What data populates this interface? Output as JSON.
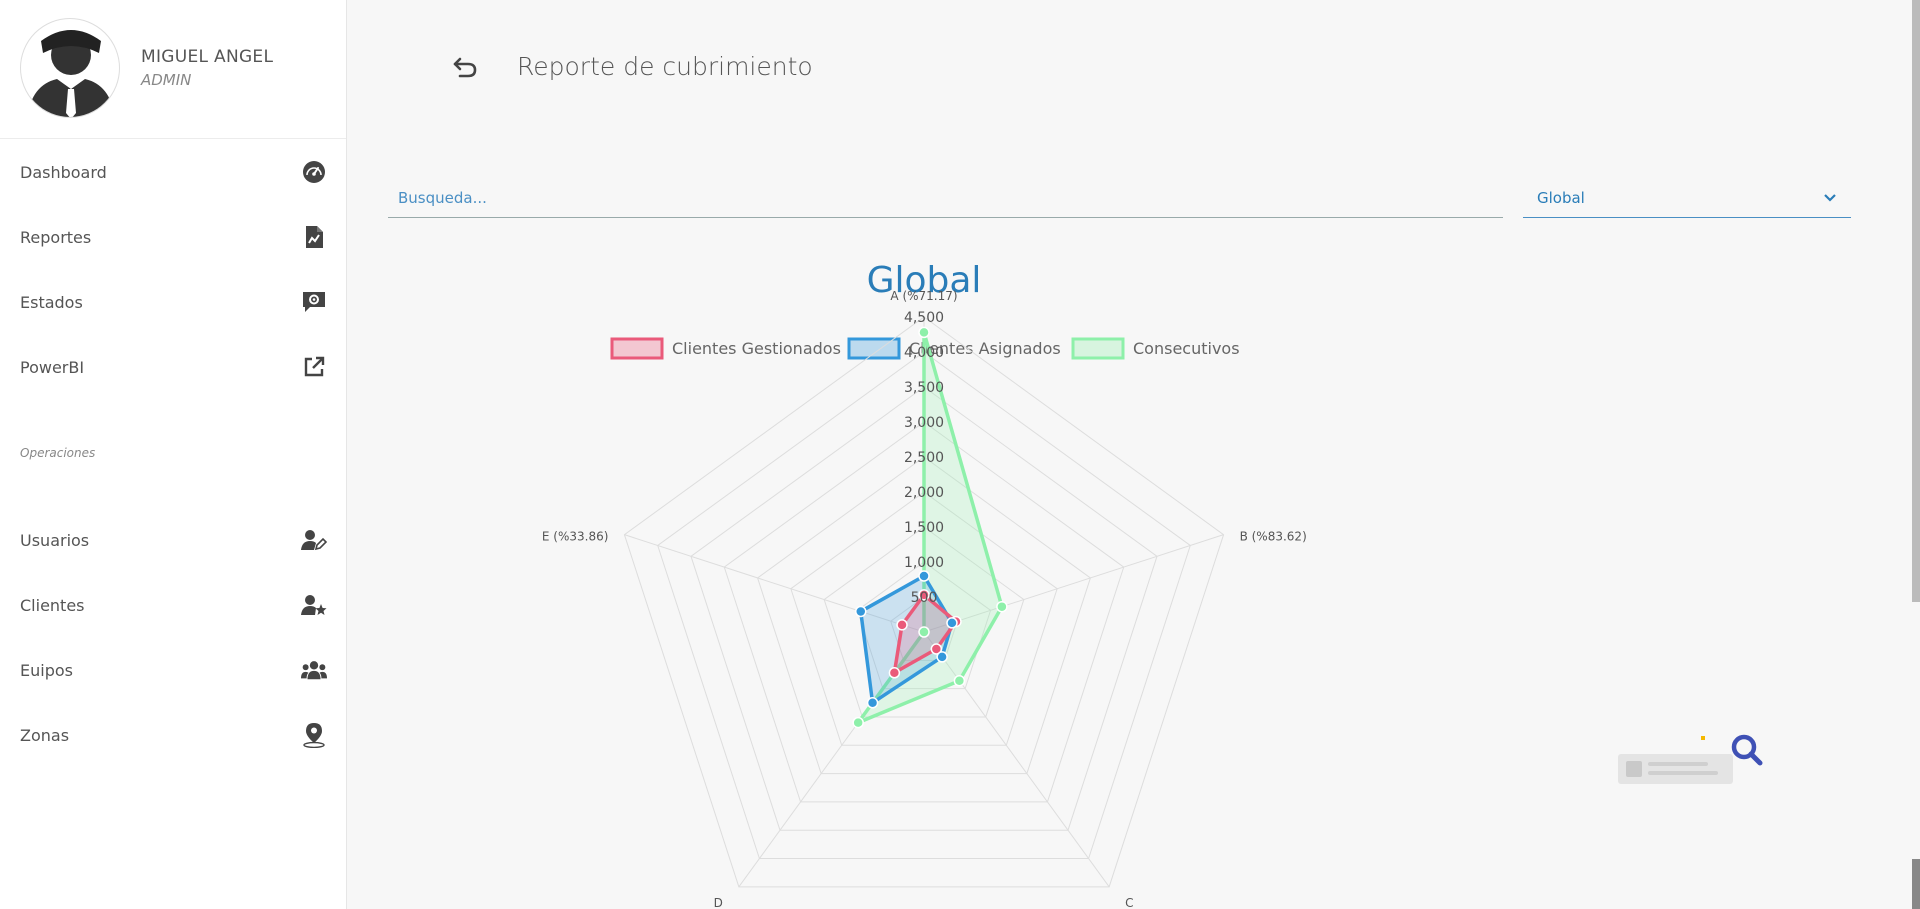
{
  "user": {
    "name": "MIGUEL ANGEL",
    "role": "ADMIN"
  },
  "nav": {
    "items": [
      {
        "label": "Dashboard",
        "icon": "gauge-icon"
      },
      {
        "label": "Reportes",
        "icon": "report-chart-icon"
      },
      {
        "label": "Estados",
        "icon": "chat-gear-icon"
      },
      {
        "label": "PowerBI",
        "icon": "external-link-icon"
      }
    ],
    "section_label": "Operaciones",
    "ops_items": [
      {
        "label": "Usuarios",
        "icon": "user-edit-icon"
      },
      {
        "label": "Clientes",
        "icon": "user-star-icon"
      },
      {
        "label": "Euipos",
        "icon": "users-group-icon"
      },
      {
        "label": "Zonas",
        "icon": "map-pin-icon"
      }
    ]
  },
  "page": {
    "title": "Reporte de cubrimiento"
  },
  "search": {
    "placeholder": "Busqueda..."
  },
  "filter": {
    "selected": "Global"
  },
  "colors": {
    "accent": "#2a7db8",
    "gestionados": "#ea5a7a",
    "asignados": "#3498db",
    "consecutivos": "#8ef0aa"
  },
  "chart_data": {
    "type": "radar",
    "title": "Global",
    "categories": [
      "A (%71.17)",
      "B (%83.62)",
      "C",
      "D",
      "E (%33.86)"
    ],
    "r_ticks": [
      "500",
      "1,000",
      "1,500",
      "2,000",
      "2,500",
      "3,000",
      "3,500",
      "4,000",
      "4,500"
    ],
    "rlim": [
      0,
      4500
    ],
    "legend_position": "top",
    "series": [
      {
        "name": "Clientes Gestionados",
        "values": [
          530,
          480,
          300,
          720,
          330
        ],
        "color": "#ea5a7a"
      },
      {
        "name": "Clientes Asignados",
        "values": [
          800,
          420,
          440,
          1250,
          950
        ],
        "color": "#3498db"
      },
      {
        "name": "Consecutivos",
        "values": [
          4280,
          1170,
          860,
          1600,
          0
        ],
        "color": "#8ef0aa"
      }
    ]
  }
}
